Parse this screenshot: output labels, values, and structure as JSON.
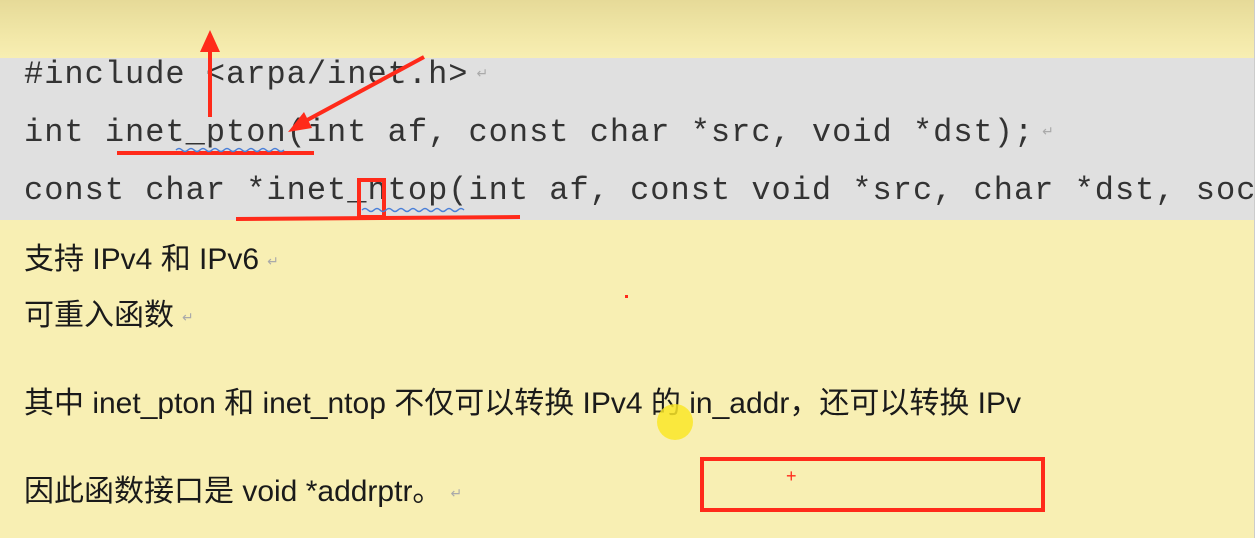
{
  "code_block": {
    "lines": [
      "#include <arpa/inet.h>",
      "int inet_pton(int af, const char *src, void *dst);",
      "const char *inet_ntop(int af, const void *src, char *dst, sock"
    ],
    "paragraph_mark": "↵"
  },
  "text": {
    "lines": [
      "支持 IPv4 和 IPv6",
      "可重入函数",
      "其中 inet_pton 和 inet_ntop 不仅可以转换 IPv4 的 in_addr，还可以转换 IPv",
      "因此函数接口是 void *addrptr。"
    ]
  },
  "annotation_color": "#ff2a1a",
  "background_color": "#f8efb3",
  "code_background": "#e0e0e0"
}
